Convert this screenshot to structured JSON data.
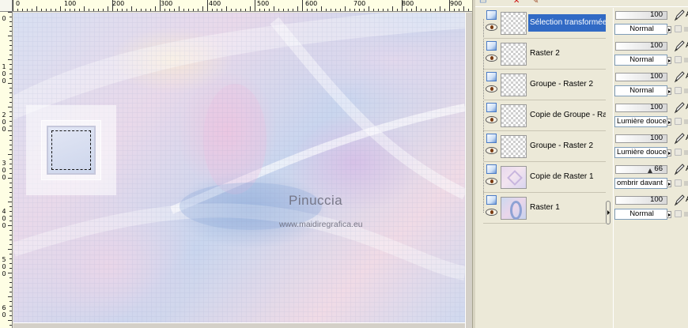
{
  "canvas": {
    "ruler_h_labels": [
      "0",
      "100",
      "200",
      "300",
      "400",
      "500",
      "600",
      "700",
      "800",
      "900"
    ],
    "ruler_v_labels": [
      "0",
      "1 0 0",
      "2 0 0",
      "3 0 0",
      "4 0 0",
      "5 0 0",
      "6 0"
    ],
    "watermark_name": "Pinuccia",
    "watermark_url": "www.maidiregrafica.eu"
  },
  "layers": [
    {
      "name": "Sélection transformée",
      "thumb": "checker",
      "selected": true,
      "opacity": "100",
      "blend": "Normal",
      "opacity_level": 100,
      "prop_letter": "A"
    },
    {
      "name": "Raster 2",
      "thumb": "checker",
      "selected": false,
      "opacity": "100",
      "blend": "Normal",
      "opacity_level": 100,
      "prop_letter": "A"
    },
    {
      "name": "Groupe - Raster 2",
      "thumb": "checker",
      "selected": false,
      "opacity": "100",
      "blend": "Normal",
      "opacity_level": 100,
      "prop_letter": "A"
    },
    {
      "name": "Copie de Groupe - Rast",
      "thumb": "checker",
      "selected": false,
      "opacity": "100",
      "blend": "Lumière douce",
      "opacity_level": 100,
      "prop_letter": "A"
    },
    {
      "name": "Groupe - Raster 2",
      "thumb": "checker",
      "selected": false,
      "opacity": "100",
      "blend": "Lumière douce",
      "opacity_level": 100,
      "prop_letter": "A"
    },
    {
      "name": "Copie de Raster 1",
      "thumb": "pink",
      "selected": false,
      "opacity": "66",
      "blend": "ombrir davant",
      "opacity_level": 66,
      "prop_letter": "A"
    },
    {
      "name": "Raster 1",
      "thumb": "blue",
      "selected": false,
      "opacity": "100",
      "blend": "Normal",
      "opacity_level": 100,
      "prop_letter": "A"
    }
  ],
  "icons": {
    "eye": "eye-icon",
    "layer_type": "raster-layer-icon",
    "brush": "brush-icon",
    "lock": "lock-icon",
    "delete": "delete-layer-icon",
    "expand": "expand-arrow-icon"
  },
  "colors": {
    "selected_row": "#316ac5",
    "panel_background": "#ece9d8",
    "ruler_background": "#fefee4"
  }
}
